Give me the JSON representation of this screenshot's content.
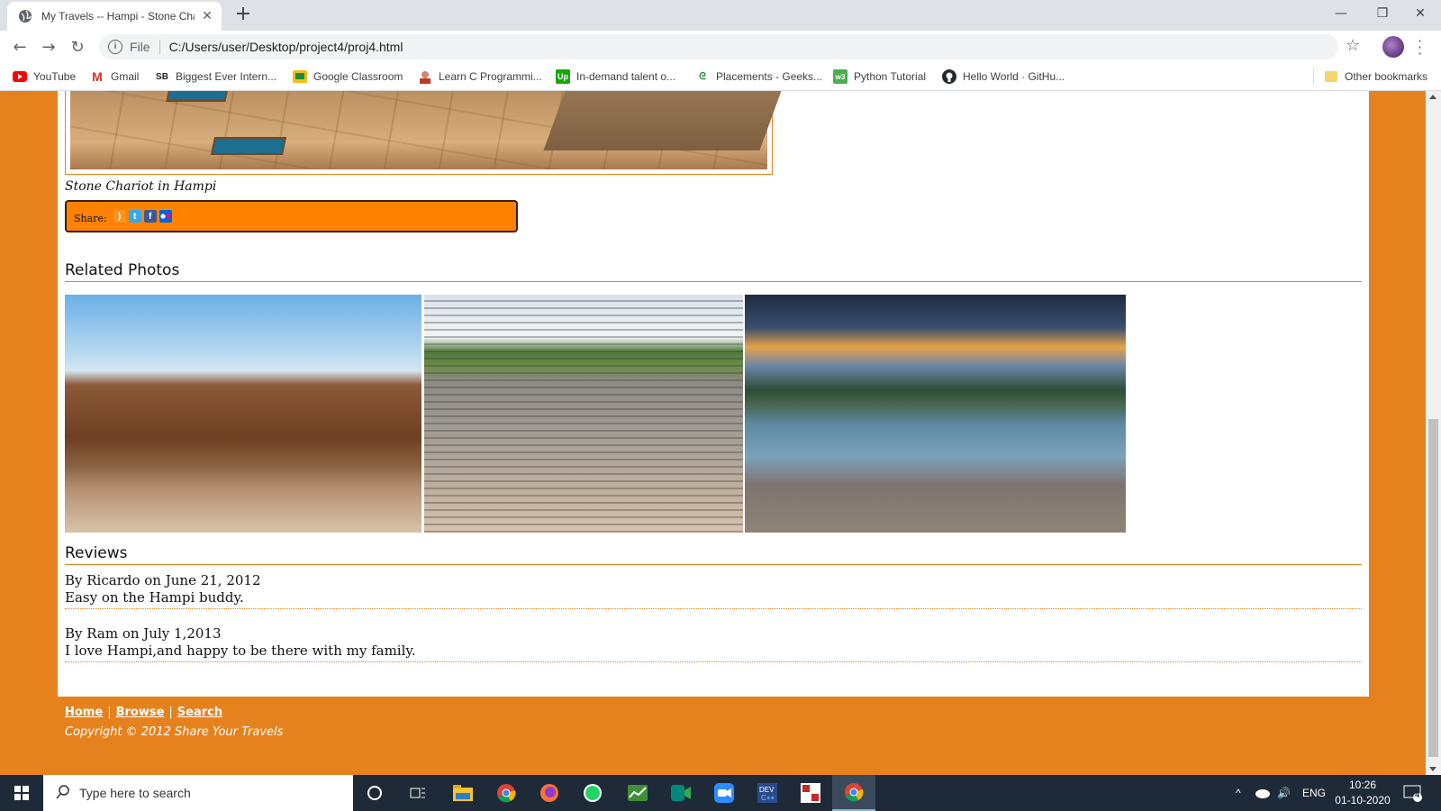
{
  "browser": {
    "tab_title": "My Travels -- Hampi - Stone Chariot",
    "new_tab": "+",
    "url_scheme": "File",
    "url": "C:/Users/user/Desktop/project4/proj4.html",
    "bookmarks": [
      {
        "label": "YouTube",
        "icon": "youtube-icon",
        "color": "#ff0000"
      },
      {
        "label": "Gmail",
        "icon": "gmail-icon",
        "color": "#d93025"
      },
      {
        "label": "Biggest Ever Intern...",
        "icon": "sb-icon",
        "color": "#222222"
      },
      {
        "label": "Google Classroom",
        "icon": "classroom-icon",
        "color": "#f9bc15"
      },
      {
        "label": "Learn C Programmi...",
        "icon": "learn-c-icon",
        "color": "#c0392b"
      },
      {
        "label": "In-demand talent o...",
        "icon": "upwork-icon",
        "color": "#14a800"
      },
      {
        "label": "Placements - Geeks...",
        "icon": "gfg-icon",
        "color": "#2f8d46"
      },
      {
        "label": "Python Tutorial",
        "icon": "w3-icon",
        "color": "#4caf50"
      },
      {
        "label": "Hello World · GitHu...",
        "icon": "github-icon",
        "color": "#24292e"
      }
    ],
    "other_bookmarks": "Other bookmarks"
  },
  "page": {
    "caption": "Stone Chariot in Hampi",
    "share_label": "Share:",
    "related_title": "Related Photos",
    "reviews_title": "Reviews",
    "reviews": [
      {
        "byline": "By Ricardo on June 21, 2012",
        "text": "Easy on the Hampi buddy."
      },
      {
        "byline": "By Ram on July 1,2013",
        "text": "I love Hampi,and happy to be there with my family."
      }
    ],
    "footer": {
      "links": [
        "Home",
        "Browse",
        "Search"
      ],
      "copyright": "Copyright © 2012 Share Your Travels"
    },
    "accent_color": "#e6821e",
    "share_bar_color": "#ff8200"
  },
  "taskbar": {
    "search_placeholder": "Type here to search",
    "language": "ENG",
    "time": "10:26",
    "date": "01-10-2020",
    "notification_count": "4"
  }
}
